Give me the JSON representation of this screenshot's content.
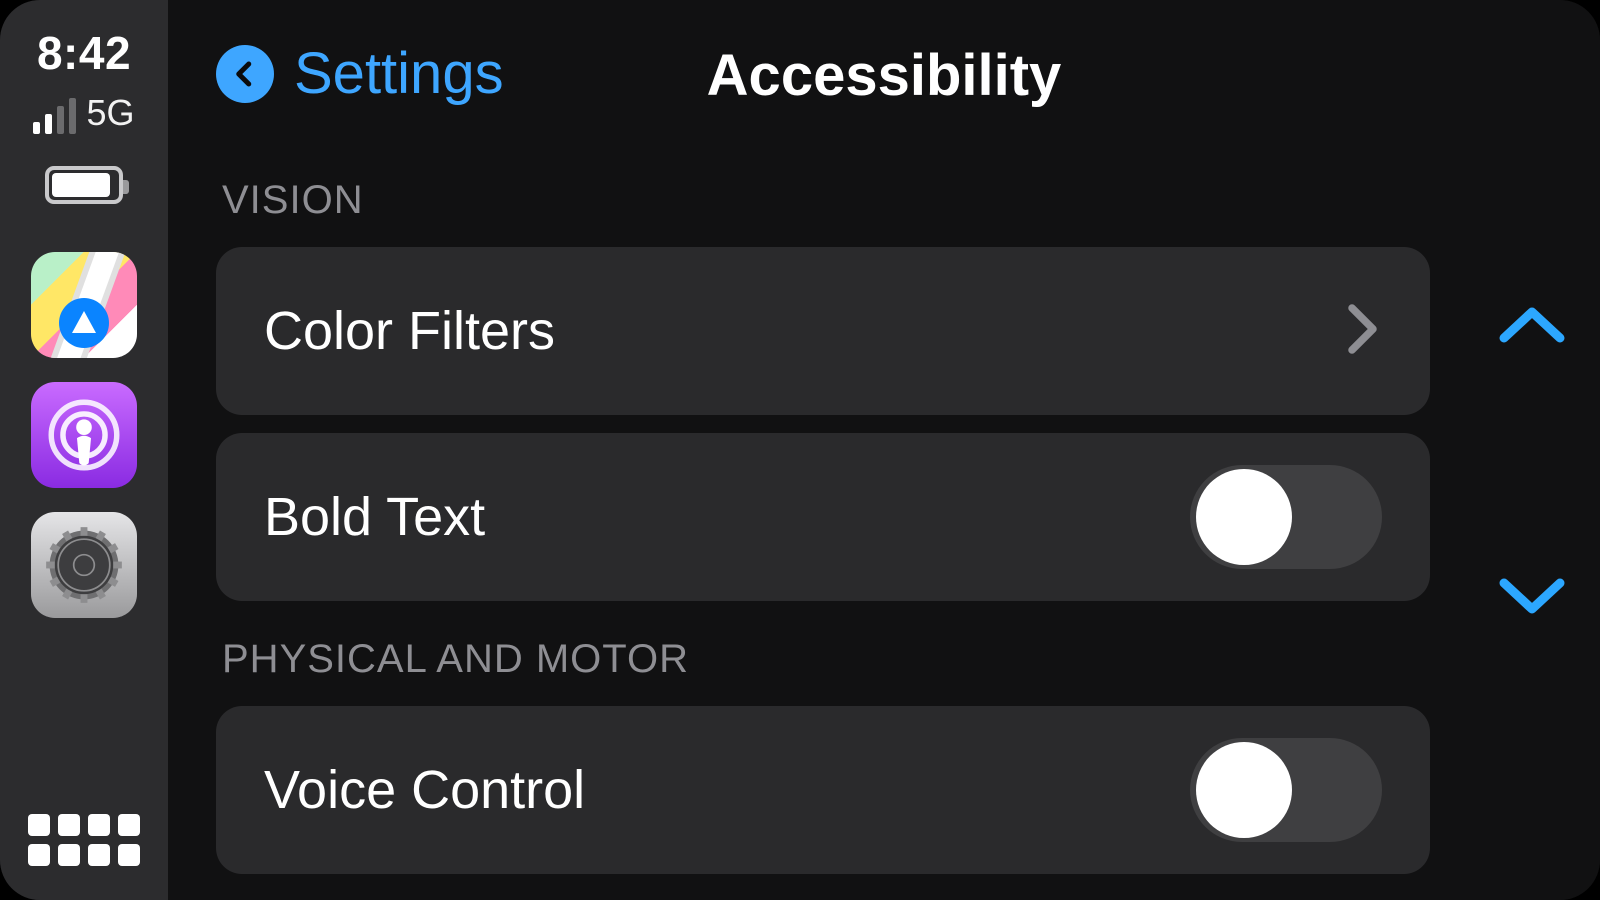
{
  "status": {
    "time": "8:42",
    "signal_bars_active": 2,
    "signal_bars_total": 4,
    "network_label": "5G",
    "battery_percent": 80
  },
  "sidebar": {
    "apps": [
      {
        "name": "maps-app-icon"
      },
      {
        "name": "podcasts-app-icon"
      },
      {
        "name": "settings-app-icon"
      }
    ],
    "dock_button": "app-grid"
  },
  "header": {
    "back_label": "Settings",
    "title": "Accessibility"
  },
  "sections": [
    {
      "header": "VISION",
      "rows": [
        {
          "label": "Color Filters",
          "type": "drilldown"
        },
        {
          "label": "Bold Text",
          "type": "toggle",
          "value": false
        }
      ]
    },
    {
      "header": "PHYSICAL AND MOTOR",
      "rows": [
        {
          "label": "Voice Control",
          "type": "toggle",
          "value": false
        }
      ]
    }
  ],
  "scroll": {
    "up": "scroll-up",
    "down": "scroll-down"
  },
  "colors": {
    "accent": "#3ea6ff",
    "row_bg": "#2a2a2c",
    "bg": "#111112",
    "sidebar_bg": "#2c2c2e"
  }
}
